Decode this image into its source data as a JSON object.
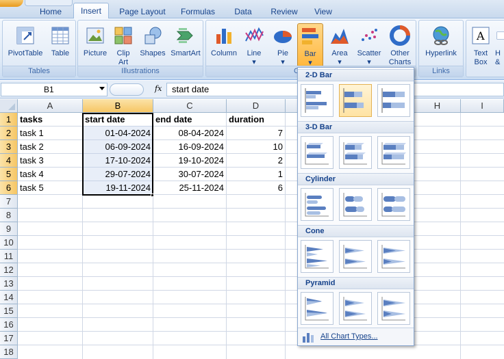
{
  "tabs": [
    "Home",
    "Insert",
    "Page Layout",
    "Formulas",
    "Data",
    "Review",
    "View"
  ],
  "active_tab": "Insert",
  "ribbon": {
    "groups": [
      "Tables",
      "Illustrations",
      "Charts",
      "Links"
    ],
    "buttons": {
      "pivottable": "PivotTable",
      "table": "Table",
      "picture": "Picture",
      "clipart1": "Clip",
      "clipart2": "Art",
      "shapes": "Shapes",
      "smartart": "SmartArt",
      "column": "Column",
      "line": "Line",
      "pie": "Pie",
      "bar": "Bar",
      "area": "Area",
      "scatter": "Scatter",
      "other1": "Other",
      "other2": "Charts",
      "hyperlink": "Hyperlink",
      "textbox1": "Text",
      "textbox2": "Box",
      "hf1": "H",
      "hf2": "&"
    },
    "charts_label_visible": "C"
  },
  "formula_bar": {
    "name_box": "B1",
    "fx": "fx",
    "content": "start date"
  },
  "grid": {
    "columns": [
      "A",
      "B",
      "C",
      "D",
      "E",
      "F",
      "G",
      "H",
      "I"
    ],
    "rows": [
      "1",
      "2",
      "3",
      "4",
      "5",
      "6",
      "7",
      "8",
      "9",
      "10",
      "11",
      "12",
      "13",
      "14",
      "15",
      "16",
      "17",
      "18"
    ],
    "headers": [
      "tasks",
      "start date",
      "end date",
      "duration"
    ],
    "data": [
      [
        "task 1",
        "01-04-2024",
        "08-04-2024",
        "7"
      ],
      [
        "task 2",
        "06-09-2024",
        "16-09-2024",
        "10"
      ],
      [
        "task 3",
        "17-10-2024",
        "19-10-2024",
        "2"
      ],
      [
        "task 4",
        "29-07-2024",
        "30-07-2024",
        "1"
      ],
      [
        "task 5",
        "19-11-2024",
        "25-11-2024",
        "6"
      ]
    ]
  },
  "bar_menu": {
    "sections": [
      "2-D Bar",
      "3-D Bar",
      "Cylinder",
      "Cone",
      "Pyramid"
    ],
    "footer": "All Chart Types..."
  },
  "colors": {
    "accent_orange": "#ffb73d",
    "ribbon_blue": "#15428b",
    "selected_header": "#f6c665"
  }
}
